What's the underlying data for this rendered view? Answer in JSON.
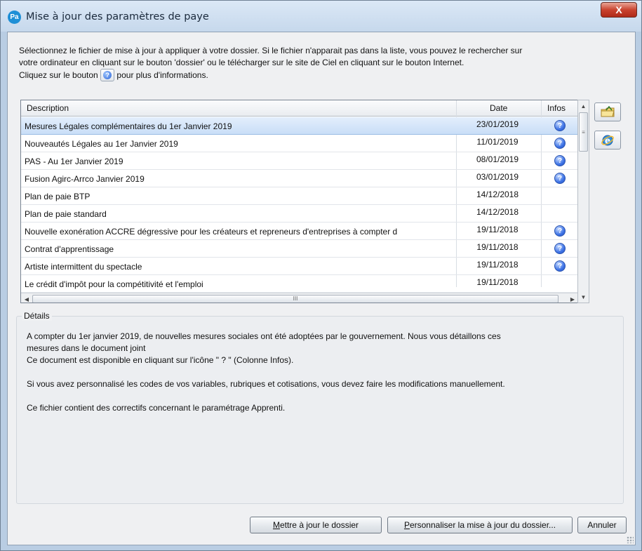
{
  "window": {
    "app_badge": "Pa",
    "title": "Mise à jour des paramètres de paye",
    "close_glyph": "X"
  },
  "intro": {
    "line1": "Sélectionnez le fichier de mise à jour à appliquer à votre dossier. Si le fichier n'apparait pas dans la liste, vous pouvez le rechercher sur",
    "line2": "votre ordinateur en cliquant sur le bouton 'dossier' ou le télécharger sur le site de Ciel en cliquant sur le bouton Internet.",
    "line3_before": "Cliquez sur le bouton",
    "line3_after": "pour plus d'informations."
  },
  "grid": {
    "columns": {
      "description": "Description",
      "date": "Date",
      "infos": "Infos"
    },
    "rows": [
      {
        "description": "Mesures Légales complémentaires du 1er Janvier 2019",
        "date": "23/01/2019",
        "info": true,
        "selected": true
      },
      {
        "description": "Nouveautés Légales au 1er Janvier 2019",
        "date": "11/01/2019",
        "info": true
      },
      {
        "description": "PAS - Au 1er Janvier 2019",
        "date": "08/01/2019",
        "info": true
      },
      {
        "description": "Fusion Agirc-Arrco Janvier 2019",
        "date": "03/01/2019",
        "info": true
      },
      {
        "description": "Plan de paie BTP",
        "date": "14/12/2018",
        "info": false
      },
      {
        "description": "Plan de paie standard",
        "date": "14/12/2018",
        "info": false
      },
      {
        "description": "Nouvelle exonération ACCRE dégressive pour les créateurs et repreneurs d'entreprises à compter d",
        "date": "19/11/2018",
        "info": true
      },
      {
        "description": "Contrat d'apprentissage",
        "date": "19/11/2018",
        "info": true
      },
      {
        "description": "Artiste intermittent du spectacle",
        "date": "19/11/2018",
        "info": true
      },
      {
        "description": "Le crédit d'impôt pour la compétitivité et l'emploi",
        "date": "19/11/2018",
        "info": false
      }
    ],
    "info_glyph": "?",
    "hscroll_thumb": "III",
    "vscroll_thumb": "≡"
  },
  "side_buttons": [
    {
      "icon": "folder-icon"
    },
    {
      "icon": "internet-explorer-icon"
    }
  ],
  "details": {
    "legend": "Détails",
    "para1_line1": "A compter du 1er janvier 2019, de nouvelles mesures sociales ont été adoptées par le gouvernement. Nous vous détaillons ces",
    "para1_line2": "mesures dans le document joint",
    "para1_line3": "Ce document est disponible en cliquant sur l'icône \" ? \" (Colonne Infos).",
    "para2": "Si vous avez personnalisé les codes de vos variables, rubriques et cotisations, vous devez faire les modifications manuellement.",
    "para3": "Ce fichier contient des correctifs concernant le paramétrage Apprenti."
  },
  "buttons": {
    "update_accel": "M",
    "update_rest": "ettre à jour le dossier",
    "customize_accel": "P",
    "customize_rest": "ersonnaliser la mise à jour du dossier...",
    "cancel": "Annuler"
  },
  "colors": {
    "selection": "#c9def7",
    "close_button": "#c9432f",
    "info_icon": "#3f74e6"
  }
}
